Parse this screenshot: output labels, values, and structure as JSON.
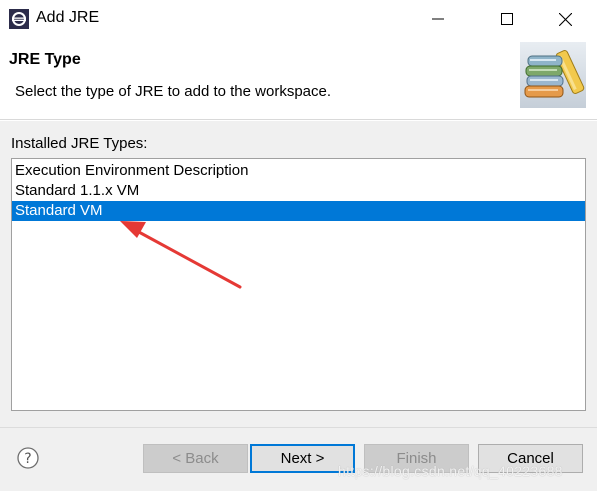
{
  "window": {
    "title": "Add JRE"
  },
  "header": {
    "title": "JRE Type",
    "description": "Select the type of JRE to add to the workspace."
  },
  "main": {
    "list_label": "Installed JRE Types:",
    "items": [
      {
        "label": "Execution Environment Description",
        "selected": false
      },
      {
        "label": "Standard 1.1.x VM",
        "selected": false
      },
      {
        "label": "Standard VM",
        "selected": true
      }
    ]
  },
  "buttons": {
    "back": "< Back",
    "next": "Next >",
    "finish": "Finish",
    "cancel": "Cancel"
  },
  "watermark": "https://blog.csdn.net/qq_40223688",
  "colors": {
    "selection": "#0078d7",
    "annotation_arrow": "#e53935",
    "dialog_background": "#f0f0f0"
  },
  "icons": {
    "app": "eclipse-icon",
    "header": "books-icon",
    "help": "help-icon"
  }
}
